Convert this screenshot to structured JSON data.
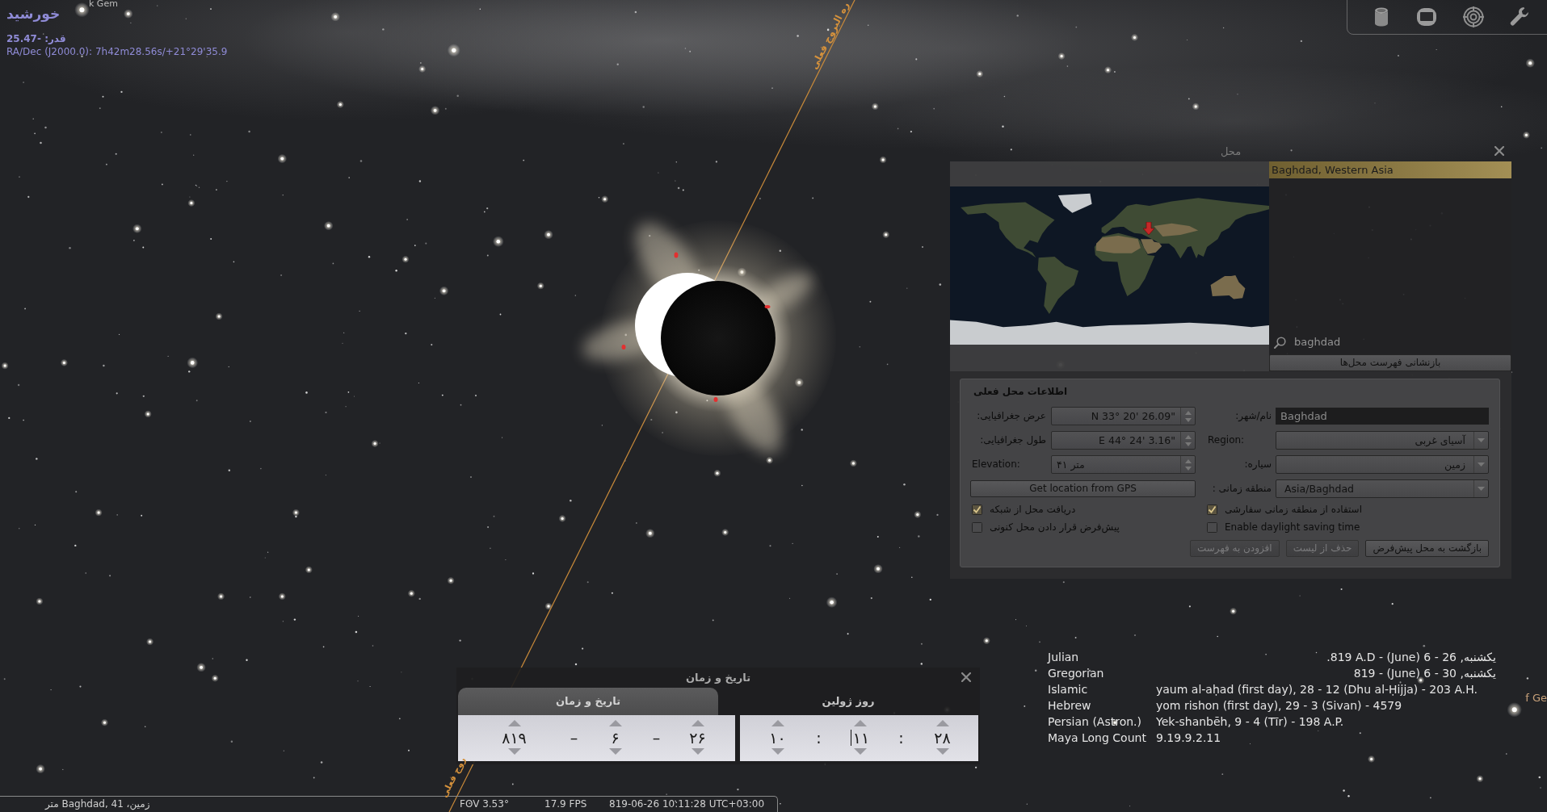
{
  "object_info": {
    "name": "خورشید",
    "magnitude": "قدر: -25.47",
    "coordinates": "RA/Dec (J2000.0): 7h42m28.56s/+21°29'35.9"
  },
  "star_labels": [
    "k Gem",
    "f Ge"
  ],
  "ecliptic_labels": [
    "ره البروج فعلی",
    "روج فعلی"
  ],
  "location_dialog": {
    "title": "محل",
    "locations": [
      {
        "label": "Baghdad, Western Asia",
        "selected": true
      }
    ],
    "search": {
      "value": "baghdad"
    },
    "reset_button": "بازنشانی فهرست محل‌ها",
    "current_location": {
      "heading": "اطلاعات محل فعلی",
      "left_fields": [
        {
          "kind": "angle",
          "label": "عرض جغرافیایی:",
          "value": "N 33° 20' 26.09\""
        },
        {
          "kind": "angle",
          "label": "طول جغرافیایی:",
          "value": "E 44° 24' 3.16\""
        },
        {
          "kind": "number",
          "label": "Elevation:",
          "value": "۴۱ متر"
        }
      ],
      "gps_button": "Get location from GPS",
      "right_fields": [
        {
          "kind": "text",
          "label": "نام/شهر:",
          "value": "Baghdad"
        },
        {
          "kind": "combo",
          "label": "Region:",
          "value": "آسیای غربی"
        },
        {
          "kind": "combo",
          "label": "سیاره:",
          "value": "زمین"
        },
        {
          "kind": "combo",
          "label": "منطقه زمانی :",
          "value": "Asia/Baghdad"
        }
      ],
      "left_checks": [
        {
          "label": "دریافت محل از شبکه",
          "checked": true
        },
        {
          "label": "پیش‌فرض قرار دادن محل کنونی",
          "checked": false
        }
      ],
      "right_checks": [
        {
          "label": "استفاده از منطقه زمانی سفارشی",
          "checked": true
        },
        {
          "label": "Enable daylight saving time",
          "checked": false
        }
      ],
      "buttons": [
        {
          "label": "بازگشت به محل پیش‌فرض",
          "disabled": false
        },
        {
          "label": "حذف از لیست",
          "disabled": true
        },
        {
          "label": "افزودن به فهرست",
          "disabled": true
        }
      ]
    }
  },
  "date_time_dialog": {
    "title": "تاریخ و زمان",
    "tabs": [
      {
        "label": "روز ژولین",
        "selected": false
      },
      {
        "label": "تاریخ و زمان",
        "selected": true
      }
    ],
    "date": [
      {
        "kind": "spin",
        "value": "۲۶",
        "focused": false
      },
      {
        "kind": "separator",
        "value": "–",
        "focused": false
      },
      {
        "kind": "spin",
        "value": "۶",
        "focused": false
      },
      {
        "kind": "separator",
        "value": "–",
        "focused": false
      },
      {
        "kind": "spin",
        "value": "۸۱۹",
        "focused": false
      }
    ],
    "time": [
      {
        "kind": "spin",
        "value": "۲۸",
        "focused": false
      },
      {
        "kind": "separator",
        "value": ":",
        "focused": false
      },
      {
        "kind": "spin",
        "value": "۱۱",
        "focused": true
      },
      {
        "kind": "separator",
        "value": ":",
        "focused": false
      },
      {
        "kind": "spin",
        "value": "۱۰",
        "focused": false
      }
    ]
  },
  "calendars": [
    {
      "name": "Julian",
      "date": ".819 A.D - (June) 6 - 26 ,یکشنبه",
      "rtl": true
    },
    {
      "name": "Gregorian",
      "date": "819 - (June) 6 - 30 ,یکشنبه",
      "rtl": true
    },
    {
      "name": "Islamic",
      "date": "yaum al-aḥad (first day), 28 - 12 (Dhu al-Ḥijja) - 203 A.H.",
      "rtl": false
    },
    {
      "name": "Hebrew",
      "date": "yom rishon (first day), 29 - 3 (Sivan) - 4579",
      "rtl": false
    },
    {
      "name": "Persian (Astron.)",
      "date": "Yek-shanbēh, 9 - 4 (Tīr) - 198 A.P.",
      "rtl": false
    },
    {
      "name": "Maya Long Count",
      "date": "9.19.9.2.11",
      "rtl": false
    }
  ],
  "status_bar": {
    "location": "متر Baghdad, 41 ،زمین",
    "fov": "FOV 3.53°",
    "fps": "17.9 FPS",
    "date_time": "819-06-26 10:11:28 UTC+03:00"
  }
}
